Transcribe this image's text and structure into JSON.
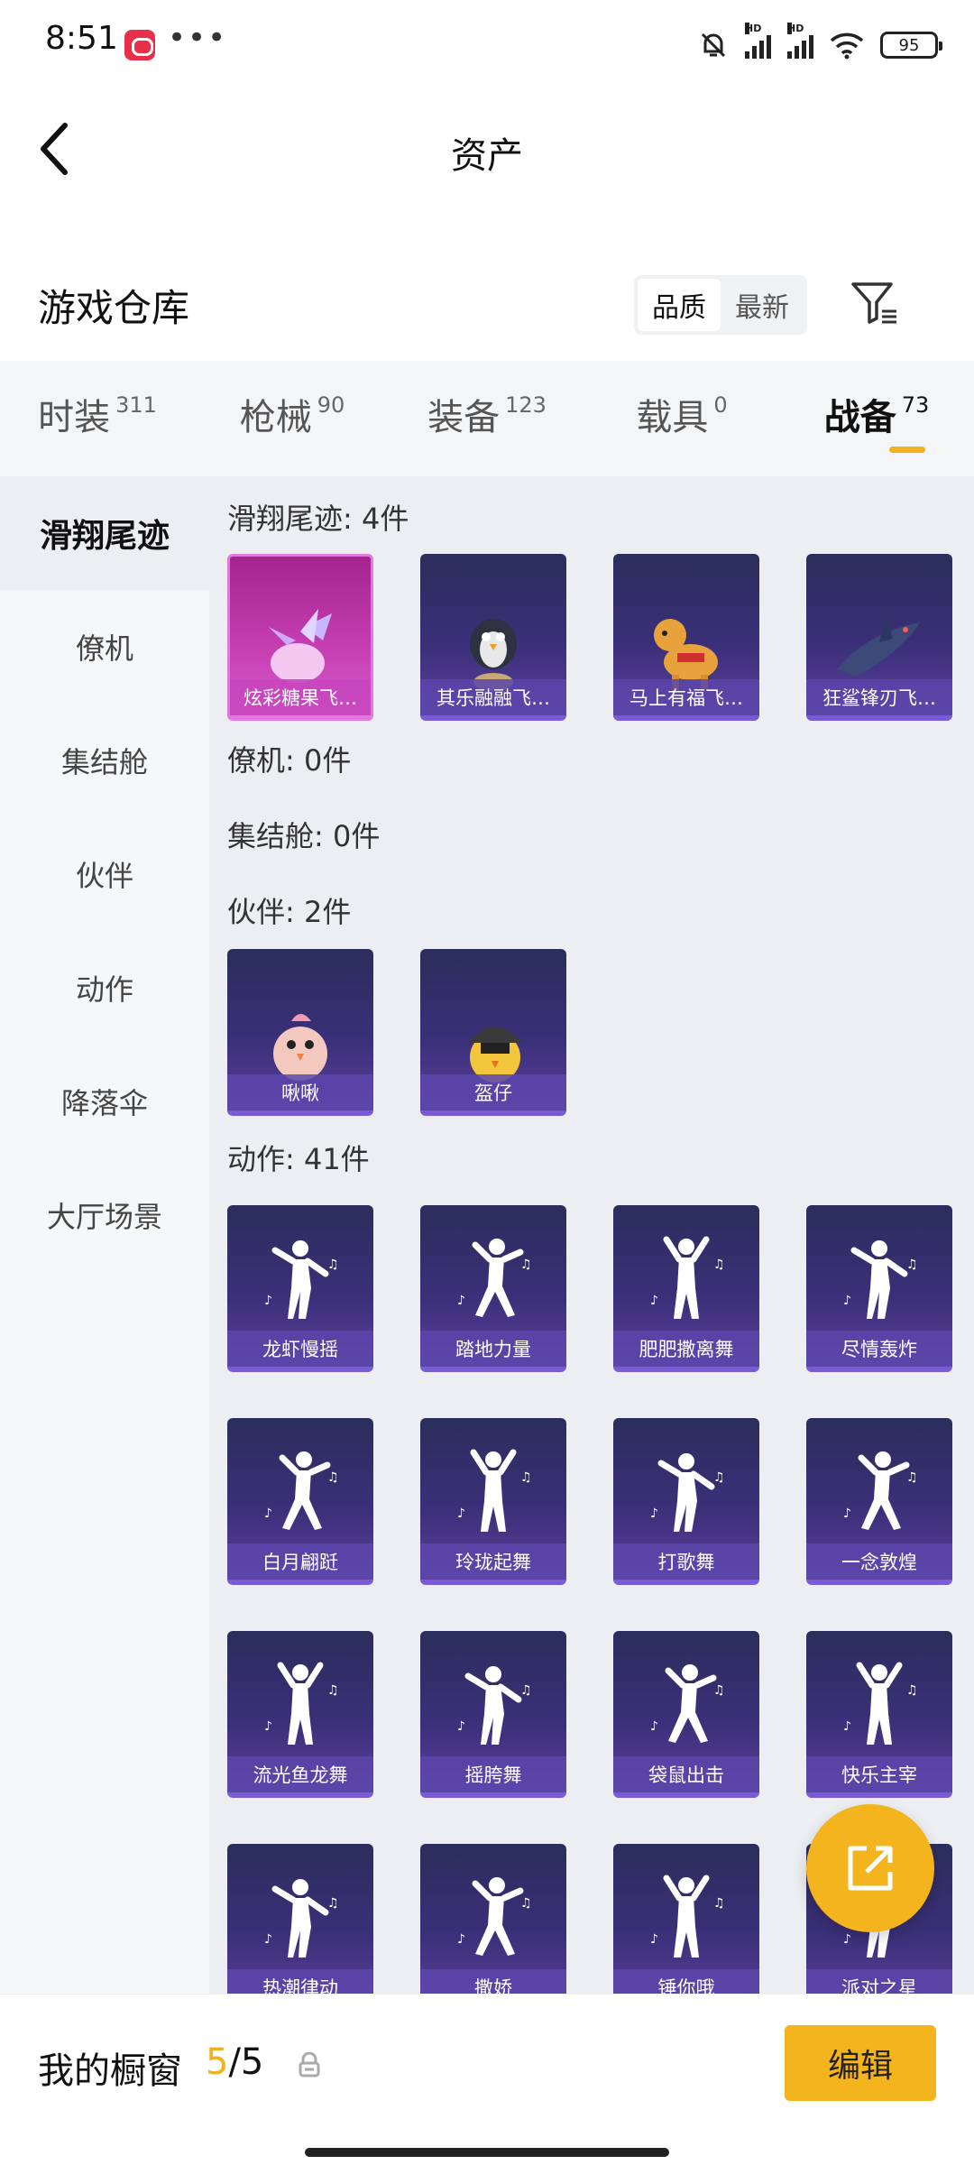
{
  "status": {
    "time": "8:51",
    "battery": "95"
  },
  "header": {
    "title": "资产"
  },
  "warehouse": {
    "title": "游戏仓库",
    "sort_options": [
      "品质",
      "最新"
    ],
    "sort_active": 0
  },
  "tabs": [
    {
      "label": "时装",
      "count": "311"
    },
    {
      "label": "枪械",
      "count": "90"
    },
    {
      "label": "装备",
      "count": "123"
    },
    {
      "label": "载具",
      "count": "0"
    },
    {
      "label": "战备",
      "count": "73"
    }
  ],
  "active_tab": 4,
  "sidebar": [
    "滑翔尾迹",
    "僚机",
    "集结舱",
    "伙伴",
    "动作",
    "降落伞",
    "大厅场景"
  ],
  "sections": {
    "glide": {
      "title": "滑翔尾迹: 4件",
      "items": [
        "炫彩糖果飞…",
        "其乐融融飞…",
        "马上有福飞…",
        "狂鲨锋刃飞…"
      ]
    },
    "wingman": {
      "title": "僚机: 0件"
    },
    "capsule": {
      "title": "集结舱: 0件"
    },
    "partner": {
      "title": "伙伴: 2件",
      "items": [
        "啾啾",
        "盔仔"
      ]
    },
    "emote": {
      "title": "动作: 41件",
      "items": [
        "龙虾慢摇",
        "踏地力量",
        "肥肥撒离舞",
        "尽情轰炸",
        "白月翩跹",
        "玲珑起舞",
        "打歌舞",
        "一念敦煌",
        "流光鱼龙舞",
        "摇胯舞",
        "袋鼠出击",
        "快乐主宰",
        "热潮律动",
        "撒娇",
        "锤你哦",
        "派对之星"
      ]
    }
  },
  "bottom": {
    "showcase_label": "我的橱窗",
    "showcase_current": "5",
    "showcase_total": "/5",
    "edit_label": "编辑"
  }
}
